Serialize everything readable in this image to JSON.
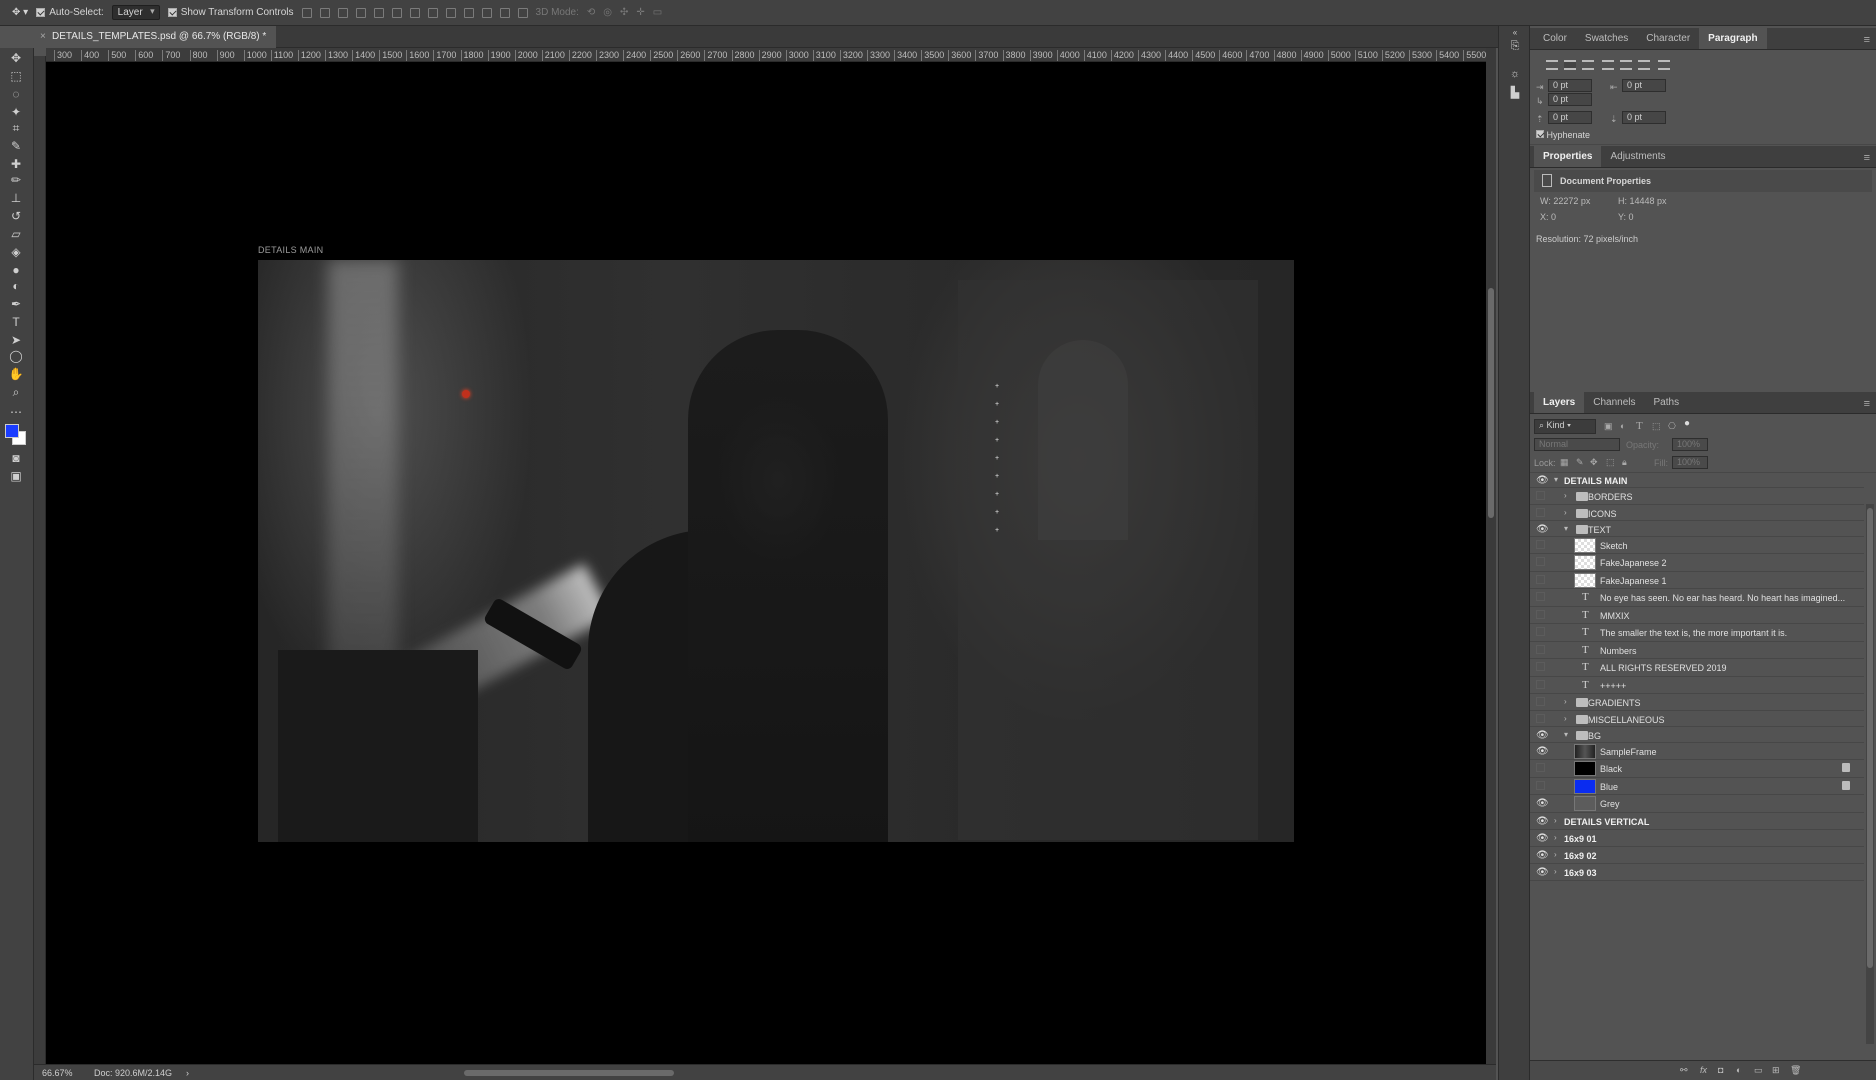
{
  "options_bar": {
    "auto_select_label": "Auto-Select:",
    "auto_select_value": "Layer",
    "show_transform_label": "Show Transform Controls",
    "mode_3d_label": "3D Mode:"
  },
  "document": {
    "tab_title": "DETAILS_TEMPLATES.psd @ 66.7% (RGB/8) *",
    "close_glyph": "×"
  },
  "ruler": {
    "ticks": [
      "300",
      "400",
      "500",
      "600",
      "700",
      "800",
      "900",
      "1000",
      "1100",
      "1200",
      "1300",
      "1400",
      "1500",
      "1600",
      "1700",
      "1800",
      "1900",
      "2000",
      "2100",
      "2200",
      "2300",
      "2400",
      "2500",
      "2600",
      "2700",
      "2800",
      "2900",
      "3000",
      "3100",
      "3200",
      "3300",
      "3400",
      "3500",
      "3600",
      "3700",
      "3800",
      "3900",
      "4000",
      "4100",
      "4200",
      "4300",
      "4400",
      "4500",
      "4600",
      "4700",
      "4800",
      "4900",
      "5000",
      "5100",
      "5200",
      "5300",
      "5400",
      "5500"
    ]
  },
  "artboard": {
    "label": "DETAILS MAIN",
    "glyphs": [
      "+",
      "+",
      "+",
      "+",
      "+",
      "+",
      "+",
      "+",
      "+"
    ]
  },
  "status": {
    "zoom": "66.67%",
    "doc_size": "Doc: 920.6M/2.14G",
    "arrow": "›"
  },
  "colors": {
    "foreground": "#1a3cff",
    "background": "#ffffff"
  },
  "panel_top": {
    "tabs": [
      "Color",
      "Swatches",
      "Character",
      "Paragraph"
    ],
    "active_tab": "Paragraph",
    "fields": {
      "indent_left": "0 pt",
      "indent_right": "0 pt",
      "indent_first": "0 pt",
      "space_before": "0 pt",
      "space_after": "0 pt"
    },
    "hyphenate_label": "Hyphenate"
  },
  "properties": {
    "tabs": [
      "Properties",
      "Adjustments"
    ],
    "active_tab": "Properties",
    "header": "Document Properties",
    "w": "W:  22272 px",
    "h": "H:  14448 px",
    "x": "X:  0",
    "y": "Y:  0",
    "resolution": "Resolution: 72 pixels/inch"
  },
  "layers_panel": {
    "tabs": [
      "Layers",
      "Channels",
      "Paths"
    ],
    "active_tab": "Layers",
    "filter_kind": "Kind",
    "blend_mode": "Normal",
    "opacity_label": "Opacity:",
    "opacity_value": "100%",
    "lock_label": "Lock:",
    "fill_label": "Fill:",
    "fill_value": "100%",
    "layers": [
      {
        "name": "DETAILS MAIN",
        "kind": "group-top",
        "visible": true,
        "open": true,
        "indent": 0
      },
      {
        "name": "BORDERS",
        "kind": "folder",
        "visible": false,
        "open": false,
        "indent": 1
      },
      {
        "name": "ICONS",
        "kind": "folder",
        "visible": false,
        "open": false,
        "indent": 1
      },
      {
        "name": "TEXT",
        "kind": "folder",
        "visible": true,
        "open": true,
        "indent": 1
      },
      {
        "name": "Sketch",
        "kind": "image",
        "visible": false,
        "indent": 2
      },
      {
        "name": "FakeJapanese 2",
        "kind": "image",
        "visible": false,
        "indent": 2
      },
      {
        "name": "FakeJapanese 1",
        "kind": "image",
        "visible": false,
        "indent": 2
      },
      {
        "name": "No eye has seen. No ear has heard. No heart has imagined...",
        "kind": "text",
        "visible": false,
        "indent": 2
      },
      {
        "name": "MMXIX",
        "kind": "text",
        "visible": false,
        "indent": 2
      },
      {
        "name": "The smaller the text is, the more important it is.",
        "kind": "text",
        "visible": false,
        "indent": 2
      },
      {
        "name": "Numbers",
        "kind": "text",
        "visible": false,
        "indent": 2
      },
      {
        "name": "ALL RIGHTS RESERVED 2019",
        "kind": "text",
        "visible": false,
        "indent": 2
      },
      {
        "name": "+++++",
        "kind": "text",
        "visible": false,
        "indent": 2
      },
      {
        "name": "GRADIENTS",
        "kind": "folder",
        "visible": false,
        "open": false,
        "indent": 1
      },
      {
        "name": "MISCELLANEOUS",
        "kind": "folder",
        "visible": false,
        "open": false,
        "indent": 1
      },
      {
        "name": "BG",
        "kind": "folder",
        "visible": true,
        "open": true,
        "indent": 1
      },
      {
        "name": "SampleFrame",
        "kind": "photo",
        "visible": true,
        "indent": 2
      },
      {
        "name": "Black",
        "kind": "fill",
        "fill": "#000000",
        "visible": false,
        "locked": true,
        "indent": 2
      },
      {
        "name": "Blue",
        "kind": "fill",
        "fill": "#0a2cf0",
        "visible": false,
        "locked": true,
        "indent": 2
      },
      {
        "name": "Grey",
        "kind": "fill",
        "fill": "#5c5c5c",
        "visible": true,
        "indent": 2
      },
      {
        "name": "DETAILS VERTICAL",
        "kind": "group-top",
        "visible": true,
        "open": false,
        "indent": 0
      },
      {
        "name": "16x9 01",
        "kind": "group-top",
        "visible": true,
        "open": false,
        "indent": 0
      },
      {
        "name": "16x9 02",
        "kind": "group-top",
        "visible": true,
        "open": false,
        "indent": 0
      },
      {
        "name": "16x9 03",
        "kind": "group-top",
        "visible": true,
        "open": false,
        "indent": 0
      }
    ]
  }
}
